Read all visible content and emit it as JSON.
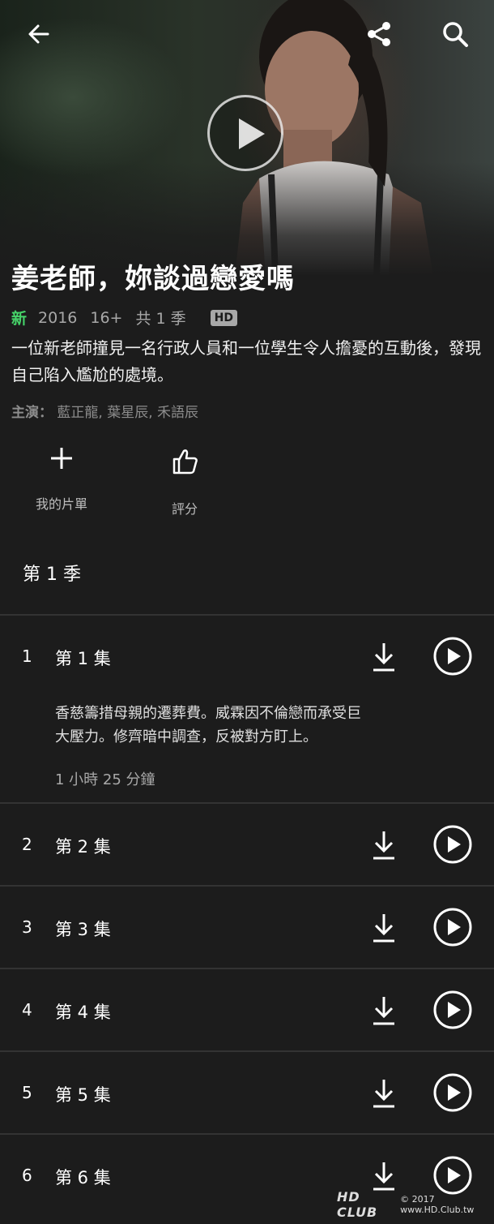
{
  "header": {
    "back_icon": "back-arrow-icon",
    "share_icon": "share-icon",
    "search_icon": "search-icon"
  },
  "hero": {
    "play_icon": "play-icon"
  },
  "show": {
    "title": "姜老師，妳談過戀愛嗎",
    "new_badge": "新",
    "year": "2016",
    "rating": "16+",
    "seasons": "共 1 季",
    "quality": "HD",
    "description": "一位新老師撞見一名行政人員和一位學生令人擔憂的互動後，發現自己陷入尷尬的處境。",
    "cast_label": "主演：",
    "cast": "藍正龍, 葉星辰, 禾語辰"
  },
  "actions": {
    "my_list": "我的片單",
    "rate": "評分"
  },
  "season_label": "第 1 季",
  "episodes": [
    {
      "num": "1",
      "name": "第 1 集",
      "description": "香慈籌措母親的遷葬費。威霖因不倫戀而承受巨大壓力。修齊暗中調查，反被對方盯上。",
      "duration": "1 小時 25 分鐘"
    },
    {
      "num": "2",
      "name": "第 2 集"
    },
    {
      "num": "3",
      "name": "第 3 集"
    },
    {
      "num": "4",
      "name": "第 4 集"
    },
    {
      "num": "5",
      "name": "第 5 集"
    },
    {
      "num": "6",
      "name": "第 6 集"
    }
  ],
  "watermark": {
    "logo": "HD CLUB",
    "text": "© 2017 www.HD.Club.tw"
  },
  "colors": {
    "background": "#1c1c1c",
    "new_badge": "#46d369",
    "muted_text": "#a8a8a8"
  }
}
